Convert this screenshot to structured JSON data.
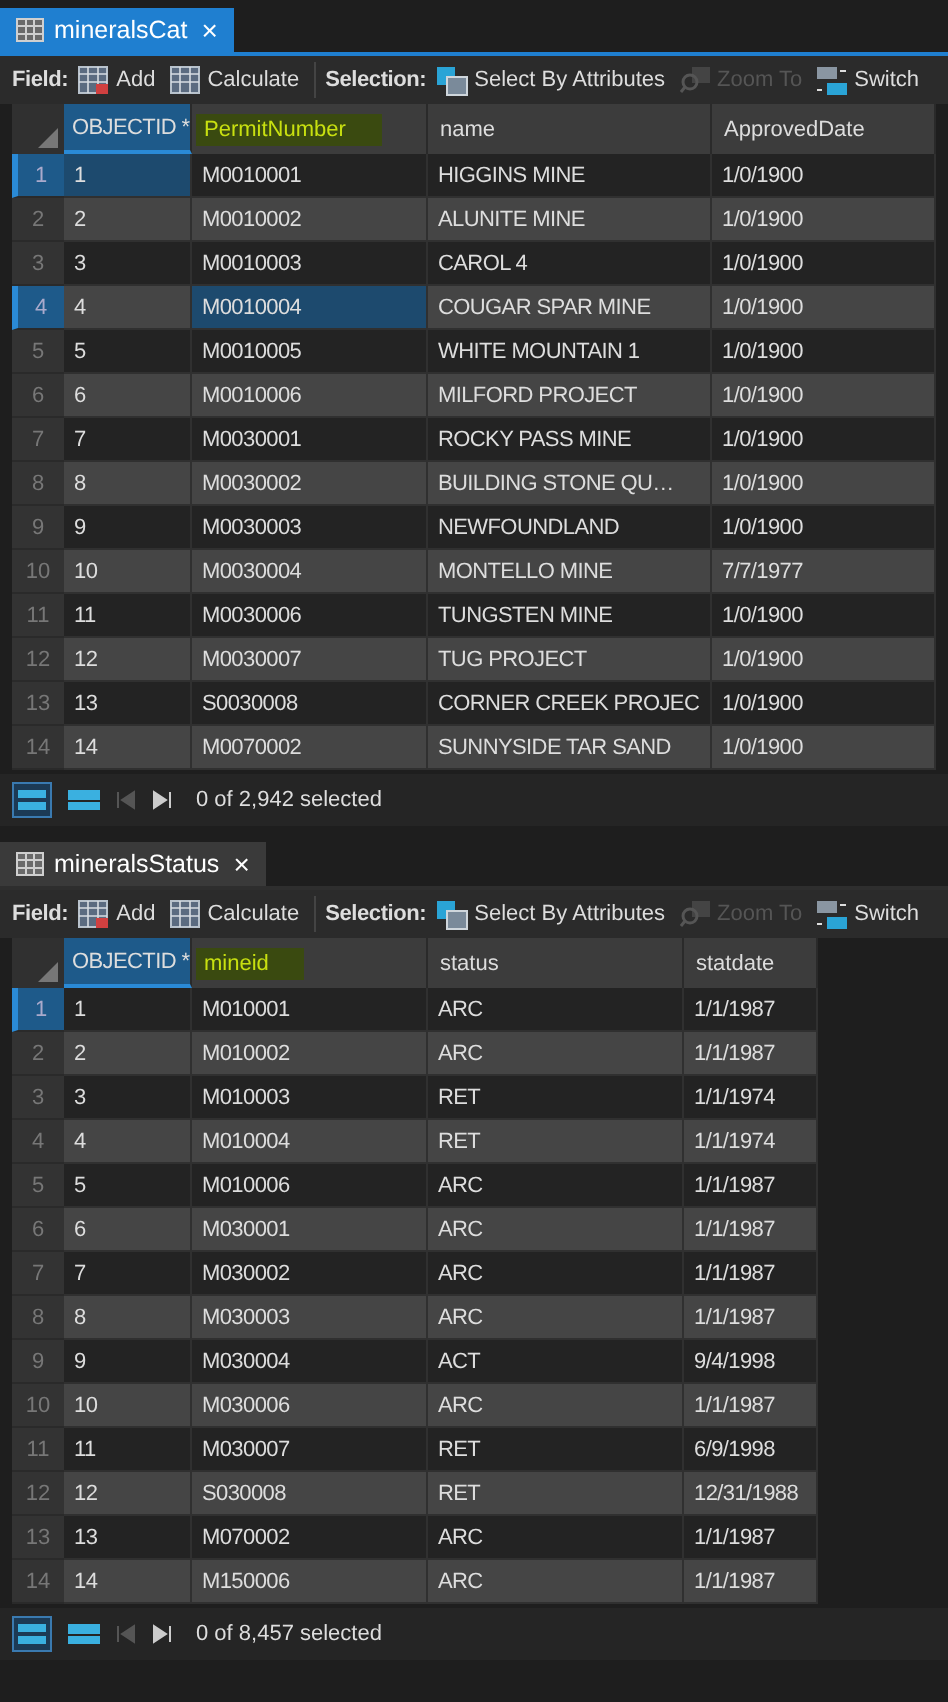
{
  "tables": [
    {
      "tab": {
        "title": "mineralsCat",
        "close": "×"
      },
      "toolbar": {
        "field_label": "Field:",
        "field_buttons": [
          {
            "kind": "add",
            "label": "Add",
            "disabled": false
          },
          {
            "kind": "calculate",
            "label": "Calculate",
            "disabled": false
          }
        ],
        "selection_label": "Selection:",
        "selection_buttons": [
          {
            "kind": "select",
            "label": "Select By Attributes",
            "disabled": false
          },
          {
            "kind": "zoom",
            "label": "Zoom To",
            "disabled": true
          },
          {
            "kind": "switch",
            "label": "Switch",
            "disabled": false
          }
        ]
      },
      "columns": [
        {
          "label": "OBJECTID *",
          "selected": true,
          "highlighted": false
        },
        {
          "label": "PermitNumber",
          "selected": false,
          "highlighted": true
        },
        {
          "label": "name",
          "selected": false,
          "highlighted": false
        },
        {
          "label": "ApprovedDate",
          "selected": false,
          "highlighted": false
        }
      ],
      "rows": [
        {
          "num": "1",
          "selected": true,
          "cells": [
            {
              "text": "1",
              "selected": true
            },
            {
              "text": "M0010001",
              "selected": false
            },
            {
              "text": "HIGGINS MINE",
              "selected": false
            },
            {
              "text": "1/0/1900",
              "selected": false
            }
          ]
        },
        {
          "num": "2",
          "selected": false,
          "cells": [
            {
              "text": "2",
              "selected": false
            },
            {
              "text": "M0010002",
              "selected": false
            },
            {
              "text": "ALUNITE MINE",
              "selected": false
            },
            {
              "text": "1/0/1900",
              "selected": false
            }
          ]
        },
        {
          "num": "3",
          "selected": false,
          "cells": [
            {
              "text": "3",
              "selected": false
            },
            {
              "text": "M0010003",
              "selected": false
            },
            {
              "text": "CAROL 4",
              "selected": false
            },
            {
              "text": "1/0/1900",
              "selected": false
            }
          ]
        },
        {
          "num": "4",
          "selected": true,
          "cells": [
            {
              "text": "4",
              "selected": false
            },
            {
              "text": "M0010004",
              "selected": true
            },
            {
              "text": "COUGAR SPAR MINE",
              "selected": false
            },
            {
              "text": "1/0/1900",
              "selected": false
            }
          ]
        },
        {
          "num": "5",
          "selected": false,
          "cells": [
            {
              "text": "5",
              "selected": false
            },
            {
              "text": "M0010005",
              "selected": false
            },
            {
              "text": "WHITE MOUNTAIN  1",
              "selected": false
            },
            {
              "text": "1/0/1900",
              "selected": false
            }
          ]
        },
        {
          "num": "6",
          "selected": false,
          "cells": [
            {
              "text": "6",
              "selected": false
            },
            {
              "text": "M0010006",
              "selected": false
            },
            {
              "text": "MILFORD PROJECT",
              "selected": false
            },
            {
              "text": "1/0/1900",
              "selected": false
            }
          ]
        },
        {
          "num": "7",
          "selected": false,
          "cells": [
            {
              "text": "7",
              "selected": false
            },
            {
              "text": "M0030001",
              "selected": false
            },
            {
              "text": "ROCKY PASS MINE",
              "selected": false
            },
            {
              "text": "1/0/1900",
              "selected": false
            }
          ]
        },
        {
          "num": "8",
          "selected": false,
          "cells": [
            {
              "text": "8",
              "selected": false
            },
            {
              "text": "M0030002",
              "selected": false
            },
            {
              "text": "BUILDING STONE QU…",
              "selected": false
            },
            {
              "text": "1/0/1900",
              "selected": false
            }
          ]
        },
        {
          "num": "9",
          "selected": false,
          "cells": [
            {
              "text": "9",
              "selected": false
            },
            {
              "text": "M0030003",
              "selected": false
            },
            {
              "text": "NEWFOUNDLAND",
              "selected": false
            },
            {
              "text": "1/0/1900",
              "selected": false
            }
          ]
        },
        {
          "num": "10",
          "selected": false,
          "cells": [
            {
              "text": "10",
              "selected": false
            },
            {
              "text": "M0030004",
              "selected": false
            },
            {
              "text": "MONTELLO MINE",
              "selected": false
            },
            {
              "text": "7/7/1977",
              "selected": false
            }
          ]
        },
        {
          "num": "11",
          "selected": false,
          "cells": [
            {
              "text": "11",
              "selected": false
            },
            {
              "text": "M0030006",
              "selected": false
            },
            {
              "text": "TUNGSTEN MINE",
              "selected": false
            },
            {
              "text": "1/0/1900",
              "selected": false
            }
          ]
        },
        {
          "num": "12",
          "selected": false,
          "cells": [
            {
              "text": "12",
              "selected": false
            },
            {
              "text": "M0030007",
              "selected": false
            },
            {
              "text": "TUG PROJECT",
              "selected": false
            },
            {
              "text": "1/0/1900",
              "selected": false
            }
          ]
        },
        {
          "num": "13",
          "selected": false,
          "cells": [
            {
              "text": "13",
              "selected": false
            },
            {
              "text": "S0030008",
              "selected": false
            },
            {
              "text": "CORNER CREEK PROJEC",
              "selected": false
            },
            {
              "text": "1/0/1900",
              "selected": false
            }
          ]
        },
        {
          "num": "14",
          "selected": false,
          "cells": [
            {
              "text": "14",
              "selected": false
            },
            {
              "text": "M0070002",
              "selected": false
            },
            {
              "text": "SUNNYSIDE TAR SAND",
              "selected": false
            },
            {
              "text": "1/0/1900",
              "selected": false
            }
          ]
        }
      ],
      "status": {
        "text": "0 of 2,942 selected"
      }
    },
    {
      "tab": {
        "title": "mineralsStatus",
        "close": "×"
      },
      "toolbar": {
        "field_label": "Field:",
        "field_buttons": [
          {
            "kind": "add",
            "label": "Add",
            "disabled": false
          },
          {
            "kind": "calculate",
            "label": "Calculate",
            "disabled": false
          }
        ],
        "selection_label": "Selection:",
        "selection_buttons": [
          {
            "kind": "select",
            "label": "Select By Attributes",
            "disabled": false
          },
          {
            "kind": "zoom",
            "label": "Zoom To",
            "disabled": true
          },
          {
            "kind": "switch",
            "label": "Switch",
            "disabled": false
          }
        ]
      },
      "columns": [
        {
          "label": "OBJECTID *",
          "selected": true,
          "highlighted": false
        },
        {
          "label": "mineid",
          "selected": false,
          "highlighted": true
        },
        {
          "label": "status",
          "selected": false,
          "highlighted": false
        },
        {
          "label": "statdate",
          "selected": false,
          "highlighted": false
        }
      ],
      "rows": [
        {
          "num": "1",
          "selected": true,
          "cells": [
            {
              "text": "1",
              "selected": false
            },
            {
              "text": "M010001",
              "selected": false
            },
            {
              "text": "ARC",
              "selected": false
            },
            {
              "text": "1/1/1987",
              "selected": false
            }
          ]
        },
        {
          "num": "2",
          "selected": false,
          "cells": [
            {
              "text": "2",
              "selected": false
            },
            {
              "text": "M010002",
              "selected": false
            },
            {
              "text": "ARC",
              "selected": false
            },
            {
              "text": "1/1/1987",
              "selected": false
            }
          ]
        },
        {
          "num": "3",
          "selected": false,
          "cells": [
            {
              "text": "3",
              "selected": false
            },
            {
              "text": "M010003",
              "selected": false
            },
            {
              "text": "RET",
              "selected": false
            },
            {
              "text": "1/1/1974",
              "selected": false
            }
          ]
        },
        {
          "num": "4",
          "selected": false,
          "cells": [
            {
              "text": "4",
              "selected": false
            },
            {
              "text": "M010004",
              "selected": false
            },
            {
              "text": "RET",
              "selected": false
            },
            {
              "text": "1/1/1974",
              "selected": false
            }
          ]
        },
        {
          "num": "5",
          "selected": false,
          "cells": [
            {
              "text": "5",
              "selected": false
            },
            {
              "text": "M010006",
              "selected": false
            },
            {
              "text": "ARC",
              "selected": false
            },
            {
              "text": "1/1/1987",
              "selected": false
            }
          ]
        },
        {
          "num": "6",
          "selected": false,
          "cells": [
            {
              "text": "6",
              "selected": false
            },
            {
              "text": "M030001",
              "selected": false
            },
            {
              "text": "ARC",
              "selected": false
            },
            {
              "text": "1/1/1987",
              "selected": false
            }
          ]
        },
        {
          "num": "7",
          "selected": false,
          "cells": [
            {
              "text": "7",
              "selected": false
            },
            {
              "text": "M030002",
              "selected": false
            },
            {
              "text": "ARC",
              "selected": false
            },
            {
              "text": "1/1/1987",
              "selected": false
            }
          ]
        },
        {
          "num": "8",
          "selected": false,
          "cells": [
            {
              "text": "8",
              "selected": false
            },
            {
              "text": "M030003",
              "selected": false
            },
            {
              "text": "ARC",
              "selected": false
            },
            {
              "text": "1/1/1987",
              "selected": false
            }
          ]
        },
        {
          "num": "9",
          "selected": false,
          "cells": [
            {
              "text": "9",
              "selected": false
            },
            {
              "text": "M030004",
              "selected": false
            },
            {
              "text": "ACT",
              "selected": false
            },
            {
              "text": "9/4/1998",
              "selected": false
            }
          ]
        },
        {
          "num": "10",
          "selected": false,
          "cells": [
            {
              "text": "10",
              "selected": false
            },
            {
              "text": "M030006",
              "selected": false
            },
            {
              "text": "ARC",
              "selected": false
            },
            {
              "text": "1/1/1987",
              "selected": false
            }
          ]
        },
        {
          "num": "11",
          "selected": false,
          "cells": [
            {
              "text": "11",
              "selected": false
            },
            {
              "text": "M030007",
              "selected": false
            },
            {
              "text": "RET",
              "selected": false
            },
            {
              "text": "6/9/1998",
              "selected": false
            }
          ]
        },
        {
          "num": "12",
          "selected": false,
          "cells": [
            {
              "text": "12",
              "selected": false
            },
            {
              "text": "S030008",
              "selected": false
            },
            {
              "text": "RET",
              "selected": false
            },
            {
              "text": "12/31/1988",
              "selected": false
            }
          ]
        },
        {
          "num": "13",
          "selected": false,
          "cells": [
            {
              "text": "13",
              "selected": false
            },
            {
              "text": "M070002",
              "selected": false
            },
            {
              "text": "ARC",
              "selected": false
            },
            {
              "text": "1/1/1987",
              "selected": false
            }
          ]
        },
        {
          "num": "14",
          "selected": false,
          "cells": [
            {
              "text": "14",
              "selected": false
            },
            {
              "text": "M150006",
              "selected": false
            },
            {
              "text": "ARC",
              "selected": false
            },
            {
              "text": "1/1/1987",
              "selected": false
            }
          ]
        }
      ],
      "status": {
        "text": "0 of 8,457 selected"
      }
    }
  ]
}
